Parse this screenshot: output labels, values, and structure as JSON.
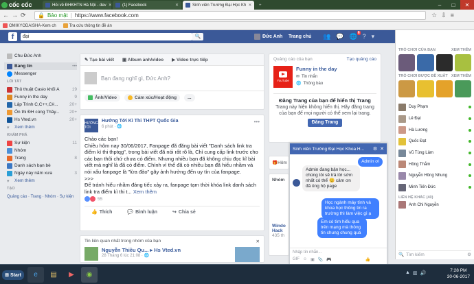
{
  "browser": {
    "brand": "cốc cốc",
    "tabs": [
      {
        "label": "Hỏi về ĐHKHTN Hà Nội - dev",
        "active": false
      },
      {
        "label": "(1) Facebook",
        "active": false
      },
      {
        "label": "Sinh viên Trường Đại Học Kh",
        "active": true
      }
    ],
    "address": {
      "secure_label": "Bảo mật",
      "url": "https://www.facebook.com"
    },
    "bookmarks": [
      "OMIKYODAISHA-Kem ch",
      "Tra cứu thông tin đề án"
    ]
  },
  "fb_header": {
    "search_value": "đại",
    "user_name": "Đức Anh",
    "home_label": "Trang chủ",
    "notif_count": "6"
  },
  "left_nav": {
    "profile": "Chu Đức Anh",
    "primary": [
      {
        "label": "Bảng tin",
        "icon": "newsfeed-icon",
        "color": "#3b5998"
      },
      {
        "label": "Messenger",
        "icon": "messenger-icon",
        "color": "#0084ff"
      }
    ],
    "shortcuts_header": "LỐI TẮT",
    "shortcuts": [
      {
        "label": "Thủ thuật Casio khối A",
        "count": "19"
      },
      {
        "label": "Funny in the day",
        "count": "9"
      },
      {
        "label": "Lập Trình C,C++,C#...",
        "count": "20+"
      },
      {
        "label": "Ôn thi ĐH cùng Thầy...",
        "count": "20+"
      },
      {
        "label": "Hs Vted.vn",
        "count": "20+"
      }
    ],
    "shortcuts_more": "Xem thêm",
    "explore_header": "KHÁM PHÁ",
    "explore": [
      {
        "label": "Sự kiện",
        "count": "11"
      },
      {
        "label": "Nhóm",
        "count": ""
      },
      {
        "label": "Trang",
        "count": "8"
      },
      {
        "label": "Danh sách bạn bè",
        "count": ""
      },
      {
        "label": "Ngày này năm xưa",
        "count": "3"
      }
    ],
    "explore_more": "Xem thêm",
    "create_header": "TẠO",
    "create_links": "Quảng cáo · Trang · Nhóm · Sự kiện"
  },
  "composer": {
    "tabs": [
      "Tạo bài viết",
      "Album ảnh/video",
      "Video trực tiếp"
    ],
    "placeholder": "Bạn đang nghĩ gì, Đức Anh?",
    "actions": [
      "Ảnh/Video",
      "Cảm xúc/Hoạt động"
    ],
    "more": "..."
  },
  "post": {
    "author": "Hướng Tới Kì Thi THPT Quốc Gia",
    "time": "6 phút · 🌐",
    "avatar_text": "HƯỚNG TỚI",
    "text": "Chào các bạn!\nChiều hôm nay 30/06/2017, Fanpage đã đăng bài viết \"Danh sách link tra điểm kì thi thptqg\", trong bài viết đã nói rất rõ là, Chỉ cung cấp link trước cho các bạn thôi chứ chưa có điểm. Nhưng nhiều bạn đã không chịu đọc kĩ bài viết mà nghĩ là đã có điểm. Chính vì thế đã có nhiều bạn đã hiểu nhầm và nói xấu fanpage là \"lừa đảo\" gây ảnh hưởng đến uy tín của fanpage.\n>>>\nĐể tránh hiểu nhầm đáng tiếc xảy ra, fanpage tạm thời khóa link danh sách link tra điểm kì thi t...",
    "see_more": "Xem thêm",
    "reaction_count": "55",
    "actions": [
      "Thích",
      "Bình luận",
      "Chia sẻ"
    ]
  },
  "suggested": {
    "header": "Tin liên quan nhất trong nhóm của bạn",
    "name": "Nguyễn Thiều Qu... ▸ Hs Vted.vn",
    "time": "28 Tháng 6 lúc 21:08 · 🌐"
  },
  "ads": {
    "header": "Quảng cáo của bạn",
    "create": "Tạo quảng cáo",
    "page_name": "Funny in the day",
    "yt_label": "YouTube",
    "sub_items": [
      "Tin nhắn",
      "Thông báo"
    ],
    "promo_title": "Đăng Trang của bạn để hiển thị Trang",
    "promo_desc": "Trang này hiện không hiển thị. Hãy đăng trang của bạn để mọi người có thể xem lại trang.",
    "promo_button": "Đăng Trang"
  },
  "partial_cards": {
    "a": "Hôm",
    "b": "Nhóm",
    "c": "Windo Hack",
    "d": "435 th"
  },
  "chat": {
    "title": "Sinh viên Trường Đại Học Khoa H...",
    "messages": [
      {
        "from": "me",
        "text": "Admin ơi"
      },
      {
        "from": "them",
        "text": "Admin đang bận học... chúng tôi sẽ trả lời sớm nhất có thể 😊 cảm ơn đã ủng hộ page"
      },
      {
        "from": "me",
        "text": "Học ngành máy tính và khoa học thông tin ra trường thì làm việc gì ạ"
      },
      {
        "from": "me",
        "text": "Em có tìm hiểu qua trên mạng mà thông tin chung chung quá"
      }
    ],
    "input_placeholder": "Nhập tin nhắn...",
    "footer_icons": [
      "gif",
      "sticker",
      "photo",
      "file",
      "game",
      "like"
    ]
  },
  "right_sidebar": {
    "games_header": "TRÒ CHƠI CỦA BẠN",
    "games_more": "XEM THÊM",
    "suggested_header": "TRÒ CHƠI ĐƯỢC ĐỀ XUẤT",
    "suggested_more": "XEM THÊM",
    "contacts": [
      "Duy Phạm",
      "Lê Đạt",
      "Hà Lương",
      "Quốc Đạt",
      "Vũ Tùng Lâm",
      "Hồng Thắm",
      "Nguyễn Hồng Nhung",
      "Minh Tiến Đức"
    ],
    "more_contacts_header": "LIÊN HỆ KHÁC (40)",
    "more_contacts": [
      "Anh Chi Nguyễn"
    ],
    "search_placeholder": "Tìm kiếm"
  },
  "taskbar": {
    "start_label": "Start",
    "time": "7:28 PM",
    "date": "30-06-2017"
  }
}
